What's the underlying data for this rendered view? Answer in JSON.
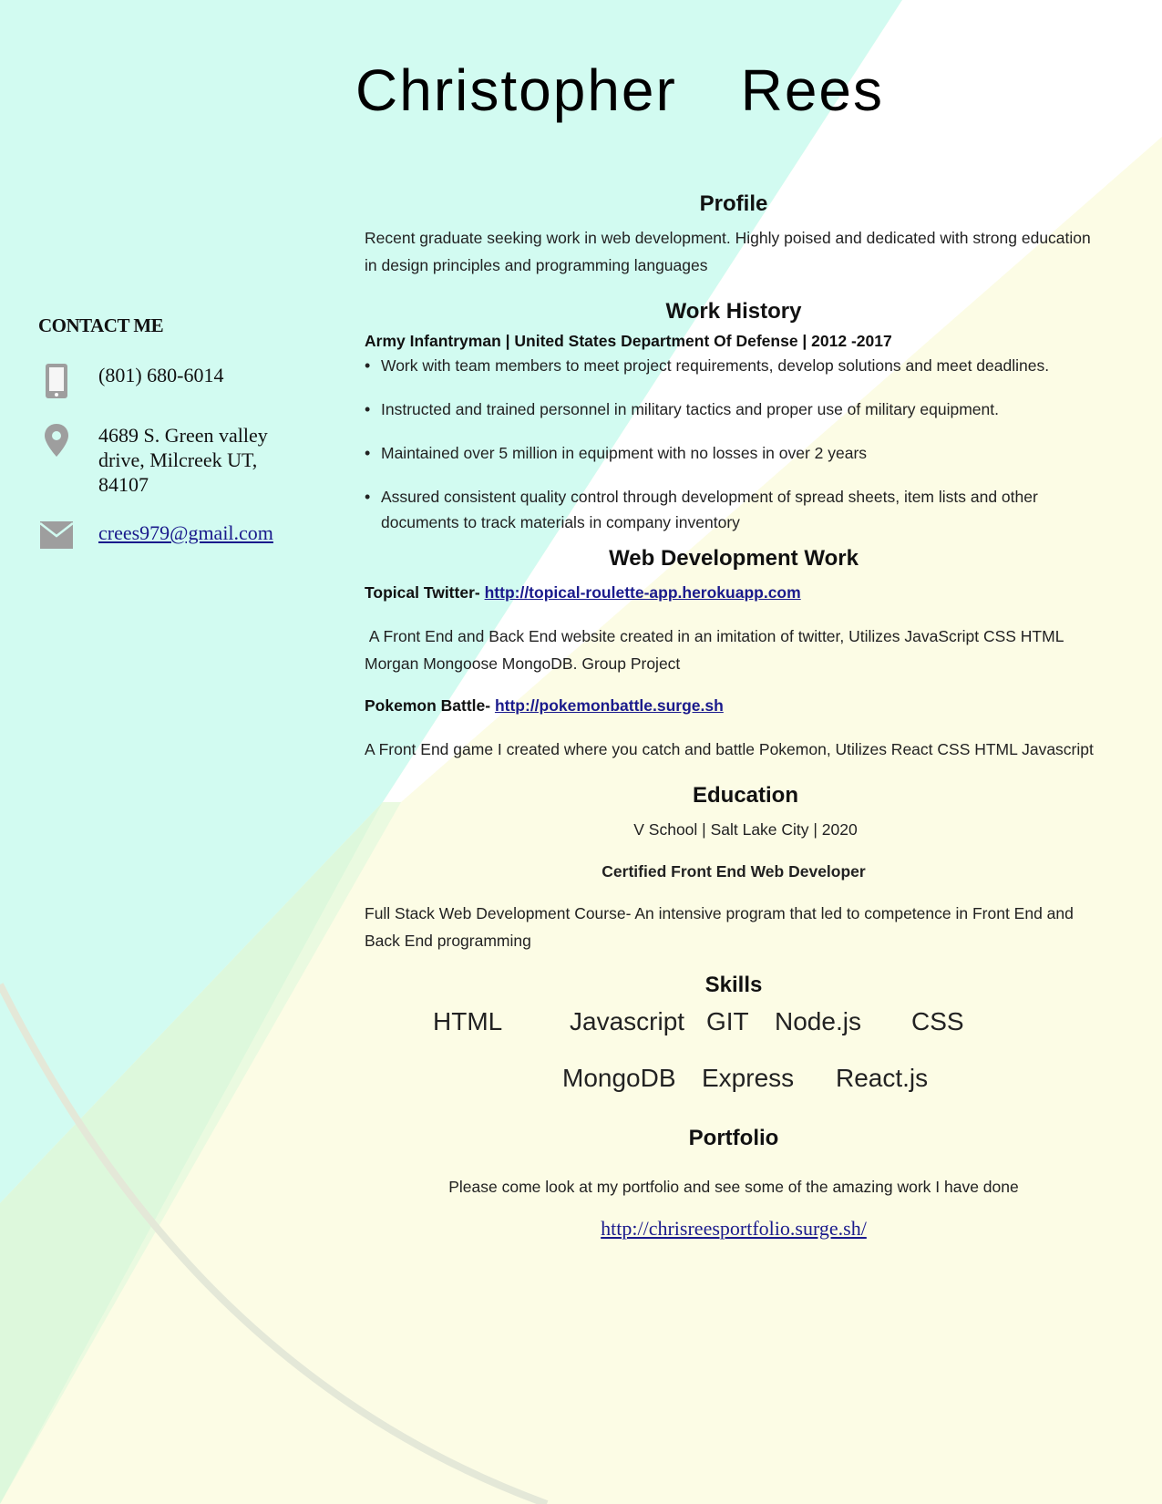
{
  "header": {
    "name": "Christopher   Rees"
  },
  "contact": {
    "heading": "CONTACT ME",
    "phone": "(801) 680-6014",
    "address": "4689 S. Green valley drive, Milcreek UT, 84107",
    "email": "crees979@gmail.com",
    "icons": {
      "phone": "phone-icon",
      "address": "location-pin-icon",
      "email": "envelope-icon"
    }
  },
  "profile": {
    "title": "Profile",
    "text": "Recent graduate seeking work in web development. Highly poised and dedicated with strong education in design principles and programming languages"
  },
  "work_history": {
    "title": "Work History",
    "job": "Army Infantryman | United States Department Of Defense | 2012 -2017",
    "bullets": [
      "Work with team members to meet project requirements, develop solutions and meet deadlines.",
      "Instructed and trained personnel in military tactics and proper use of military equipment.",
      "Maintained over 5 million in equipment with no losses in over 2 years",
      "Assured consistent quality control through development of spread sheets, item lists and other documents to track materials in company inventory"
    ]
  },
  "web_dev": {
    "title": "Web Development Work",
    "projects": [
      {
        "name": "Topical Twitter",
        "sep": "- ",
        "link": "http://topical-roulette-app.herokuapp.com",
        "description": " A Front End and Back End website created in an imitation of twitter, Utilizes JavaScript CSS HTML Morgan Mongoose MongoDB. Group Project"
      },
      {
        "name": "Pokemon Battle-",
        "sep": " ",
        "link": "http://pokemonbattle.surge.sh",
        "description": "A Front End game I created where you catch and battle Pokemon, Utilizes React CSS HTML Javascript"
      }
    ]
  },
  "education": {
    "title": "Education",
    "school": "V School | Salt Lake City | 2020",
    "cert": "Certified Front End Web Developer",
    "description": "Full Stack Web Development Course- An intensive program that led to competence in Front End and Back End programming"
  },
  "skills": {
    "title": "Skills",
    "row1": [
      "HTML",
      "Javascript",
      "GIT",
      "Node.js",
      "CSS"
    ],
    "row2": [
      "MongoDB",
      "Express",
      "React.js"
    ]
  },
  "portfolio": {
    "title": "Portfolio",
    "text": "Please come look at my portfolio and see some of the amazing work I have done",
    "link": "http://chrisreesportfolio.surge.sh/"
  },
  "colors": {
    "mint": "#d2fbf1",
    "cream": "#fcfce5",
    "green": "#dcf8dc",
    "link": "#1a1a8c"
  }
}
